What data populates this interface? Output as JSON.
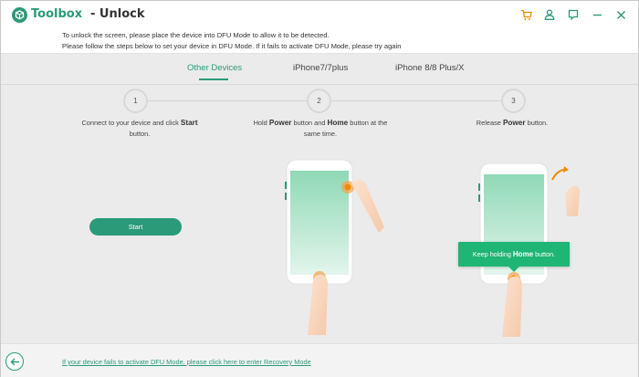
{
  "titlebar": {
    "app_name": "Toolbox",
    "page_name": "- Unlock",
    "accent_color": "#2a9a79",
    "icons": [
      "cart-icon",
      "account-icon",
      "feedback-icon",
      "minimize-icon",
      "close-icon"
    ]
  },
  "info": {
    "line1": "To unlock the screen, please place the device into DFU Mode to allow it to be detected.",
    "line2": "Please follow the steps below to set your device in DFU Mode. If it fails to activate DFU Mode, please try again"
  },
  "tabs": [
    {
      "label": "Other Devices",
      "active": true
    },
    {
      "label": "iPhone7/7plus",
      "active": false
    },
    {
      "label": "iPhone 8/8 Plus/X",
      "active": false
    }
  ],
  "steps": [
    {
      "number": "1",
      "pre": "Connect to your device and click ",
      "bold": "Start",
      "post": " button."
    },
    {
      "number": "2",
      "pre": "Hold ",
      "bold": "Power",
      "mid": " button and ",
      "bold2": "Home",
      "post": " button at the same time."
    },
    {
      "number": "3",
      "pre": "Release ",
      "bold": "Power",
      "post": " button."
    }
  ],
  "start_button": "Start",
  "tooltip": {
    "pre": "Keep holding ",
    "bold": "Home",
    "post": " button."
  },
  "footer": {
    "recovery_link": "If your device fails to activate DFU Mode, please click here to enter Recovery Mode"
  }
}
